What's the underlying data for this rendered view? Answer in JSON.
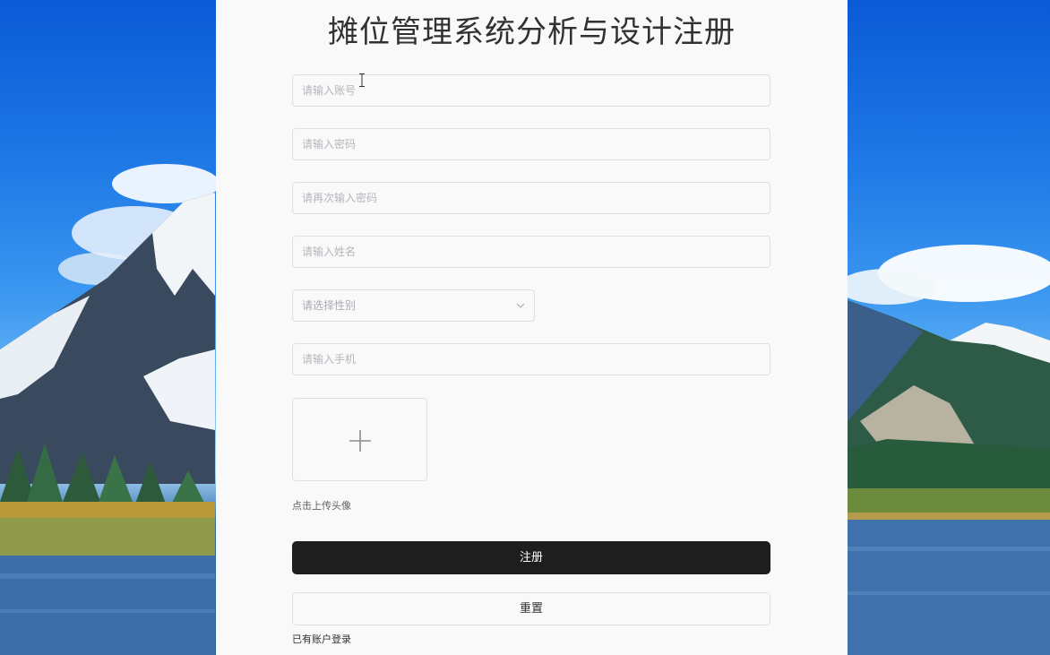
{
  "page": {
    "title": "摊位管理系统分析与设计注册"
  },
  "form": {
    "account_placeholder": "请输入账号",
    "password_placeholder": "请输入密码",
    "confirm_password_placeholder": "请再次输入密码",
    "name_placeholder": "请输入姓名",
    "gender_placeholder": "请选择性别",
    "phone_placeholder": "请输入手机",
    "avatar_hint": "点击上传头像",
    "register_label": "注册",
    "reset_label": "重置",
    "login_link": "已有账户登录"
  },
  "icons": {
    "select_arrow": "chevron-down-icon",
    "upload": "plus-icon"
  },
  "colors": {
    "primary_button": "#1e1e1e",
    "panel_background": "#f9f9f9",
    "border": "#dcdfe6"
  }
}
